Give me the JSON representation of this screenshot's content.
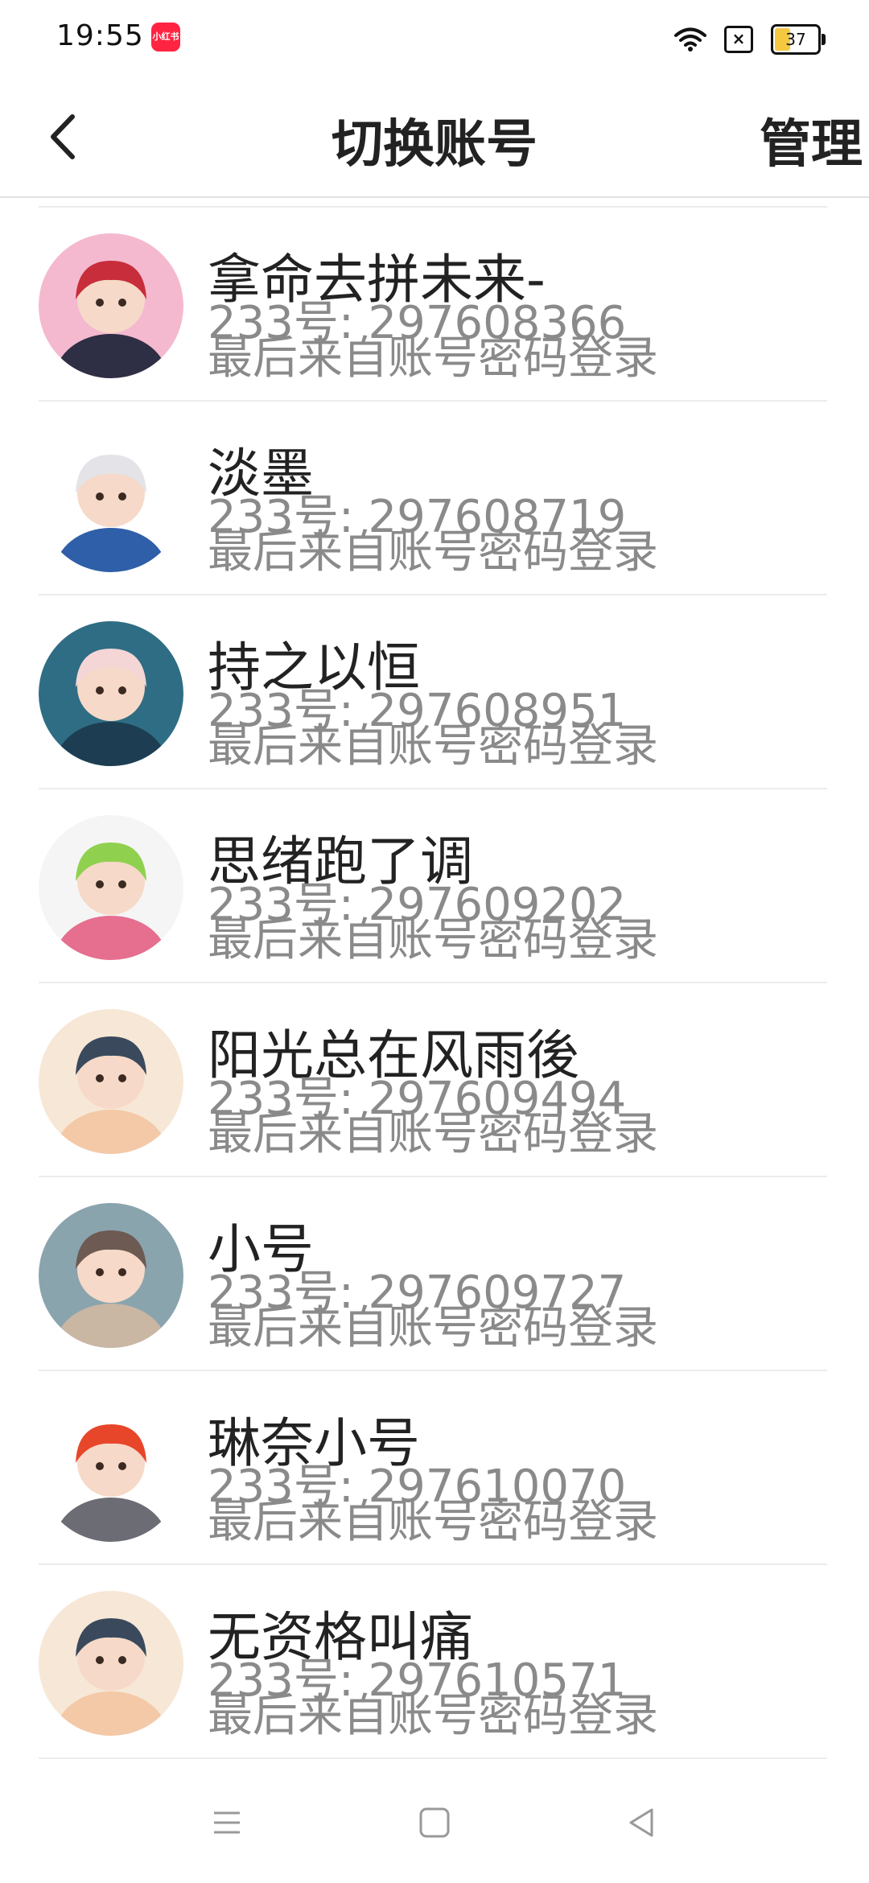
{
  "status_bar": {
    "time": "19:55",
    "app_badge": "小红书",
    "battery": "37",
    "battery_level": 0.37,
    "icons": [
      "wifi-icon",
      "close-box-icon",
      "battery-icon"
    ]
  },
  "header": {
    "title": "切换账号",
    "manage_label": "管理",
    "back_icon": "chevron-left-icon"
  },
  "accounts": [
    {
      "name": "拿命去拼未来-",
      "id": "233号: 297608366",
      "login": "最后来自账号密码登录",
      "avatar_colors": [
        "#f4b9cf",
        "#c72d3a",
        "#2e2e44"
      ]
    },
    {
      "name": "淡墨",
      "id": "233号: 297608719",
      "login": "最后来自账号密码登录",
      "avatar_colors": [
        "#ffffff",
        "#e3e3e8",
        "#2f5fa8"
      ]
    },
    {
      "name": "持之以恒",
      "id": "233号: 297608951",
      "login": "最后来自账号密码登录",
      "avatar_colors": [
        "#2f6d84",
        "#f4d6d6",
        "#1d3e52"
      ]
    },
    {
      "name": "思绪跑了调",
      "id": "233号: 297609202",
      "login": "最后来自账号密码登录",
      "avatar_colors": [
        "#f5f5f5",
        "#8fd14f",
        "#e66e8f"
      ]
    },
    {
      "name": "阳光总在风雨後",
      "id": "233号: 297609494",
      "login": "最后来自账号密码登录",
      "avatar_colors": [
        "#f7e7d6",
        "#3a4a5c",
        "#f3c9a8"
      ]
    },
    {
      "name": "小号",
      "id": "233号: 297609727",
      "login": "最后来自账号密码登录",
      "avatar_colors": [
        "#8aa4ae",
        "#6d5a52",
        "#c9b6a3"
      ]
    },
    {
      "name": "琳奈小号",
      "id": "233号: 297610070",
      "login": "最后来自账号密码登录",
      "avatar_colors": [
        "#ffffff",
        "#e8462a",
        "#6c6c74"
      ]
    },
    {
      "name": "无资格叫痛",
      "id": "233号: 297610571",
      "login": "最后来自账号密码登录",
      "avatar_colors": [
        "#f7e7d6",
        "#3a4a5c",
        "#f3c9a8"
      ]
    }
  ],
  "nav_bar": {
    "icons": [
      "menu-icon",
      "home-square-icon",
      "back-triangle-icon"
    ]
  }
}
